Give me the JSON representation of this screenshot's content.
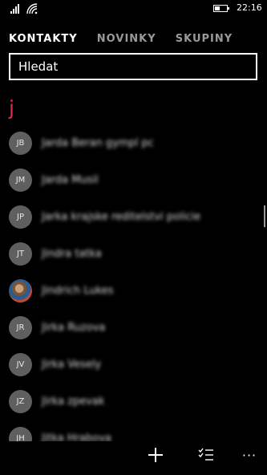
{
  "status": {
    "time": "22:16",
    "battery_level": 0.45
  },
  "pivot": {
    "tabs": [
      "KONTAKTY",
      "NOVINKY",
      "SKUPINY"
    ],
    "active_index": 0
  },
  "search": {
    "placeholder": "Hledat"
  },
  "section": {
    "letter": "j"
  },
  "contacts": [
    {
      "initials": "JB",
      "name": "Jarda Beran gympl pc",
      "photo": false
    },
    {
      "initials": "JM",
      "name": "Jarda Musil",
      "photo": false
    },
    {
      "initials": "JP",
      "name": "Jarka krajske reditelstvi policie",
      "photo": false
    },
    {
      "initials": "JT",
      "name": "Jindra tatka",
      "photo": false
    },
    {
      "initials": "",
      "name": "Jindrich Lukes",
      "photo": true
    },
    {
      "initials": "JR",
      "name": "Jirka Ruzova",
      "photo": false
    },
    {
      "initials": "JV",
      "name": "Jirka Vesely",
      "photo": false
    },
    {
      "initials": "JZ",
      "name": "Jirka zpevak",
      "photo": false
    },
    {
      "initials": "JH",
      "name": "Jitka Hrabova",
      "photo": false
    }
  ],
  "appbar": {
    "icons": [
      "add-icon",
      "select-icon",
      "more-icon"
    ]
  }
}
